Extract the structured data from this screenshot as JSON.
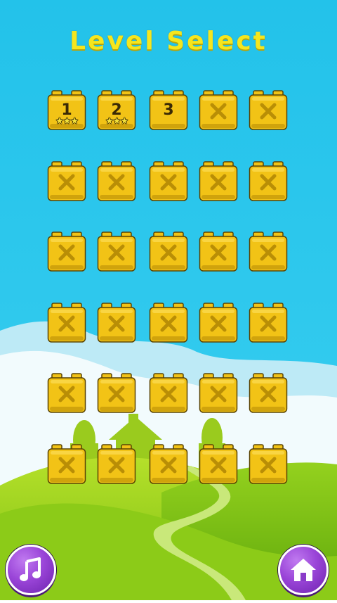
{
  "screen": {
    "title": "Level Select"
  },
  "colors": {
    "sky": "#2EC6EA",
    "block": "#F2C316",
    "block_dark": "#B98E06",
    "title": "#F5E61E",
    "button": "#9A45D8"
  },
  "levels": [
    {
      "label": "1",
      "locked": false,
      "stars": 3
    },
    {
      "label": "2",
      "locked": false,
      "stars": 3
    },
    {
      "label": "3",
      "locked": false,
      "stars": 0
    },
    {
      "label": "",
      "locked": true,
      "stars": 0
    },
    {
      "label": "",
      "locked": true,
      "stars": 0
    },
    {
      "label": "",
      "locked": true,
      "stars": 0
    },
    {
      "label": "",
      "locked": true,
      "stars": 0
    },
    {
      "label": "",
      "locked": true,
      "stars": 0
    },
    {
      "label": "",
      "locked": true,
      "stars": 0
    },
    {
      "label": "",
      "locked": true,
      "stars": 0
    },
    {
      "label": "",
      "locked": true,
      "stars": 0
    },
    {
      "label": "",
      "locked": true,
      "stars": 0
    },
    {
      "label": "",
      "locked": true,
      "stars": 0
    },
    {
      "label": "",
      "locked": true,
      "stars": 0
    },
    {
      "label": "",
      "locked": true,
      "stars": 0
    },
    {
      "label": "",
      "locked": true,
      "stars": 0
    },
    {
      "label": "",
      "locked": true,
      "stars": 0
    },
    {
      "label": "",
      "locked": true,
      "stars": 0
    },
    {
      "label": "",
      "locked": true,
      "stars": 0
    },
    {
      "label": "",
      "locked": true,
      "stars": 0
    },
    {
      "label": "",
      "locked": true,
      "stars": 0
    },
    {
      "label": "",
      "locked": true,
      "stars": 0
    },
    {
      "label": "",
      "locked": true,
      "stars": 0
    },
    {
      "label": "",
      "locked": true,
      "stars": 0
    },
    {
      "label": "",
      "locked": true,
      "stars": 0
    },
    {
      "label": "",
      "locked": true,
      "stars": 0
    },
    {
      "label": "",
      "locked": true,
      "stars": 0
    },
    {
      "label": "",
      "locked": true,
      "stars": 0
    },
    {
      "label": "",
      "locked": true,
      "stars": 0
    },
    {
      "label": "",
      "locked": true,
      "stars": 0
    }
  ],
  "buttons": {
    "music": {
      "icon": "music-note-icon"
    },
    "home": {
      "icon": "home-icon"
    }
  }
}
